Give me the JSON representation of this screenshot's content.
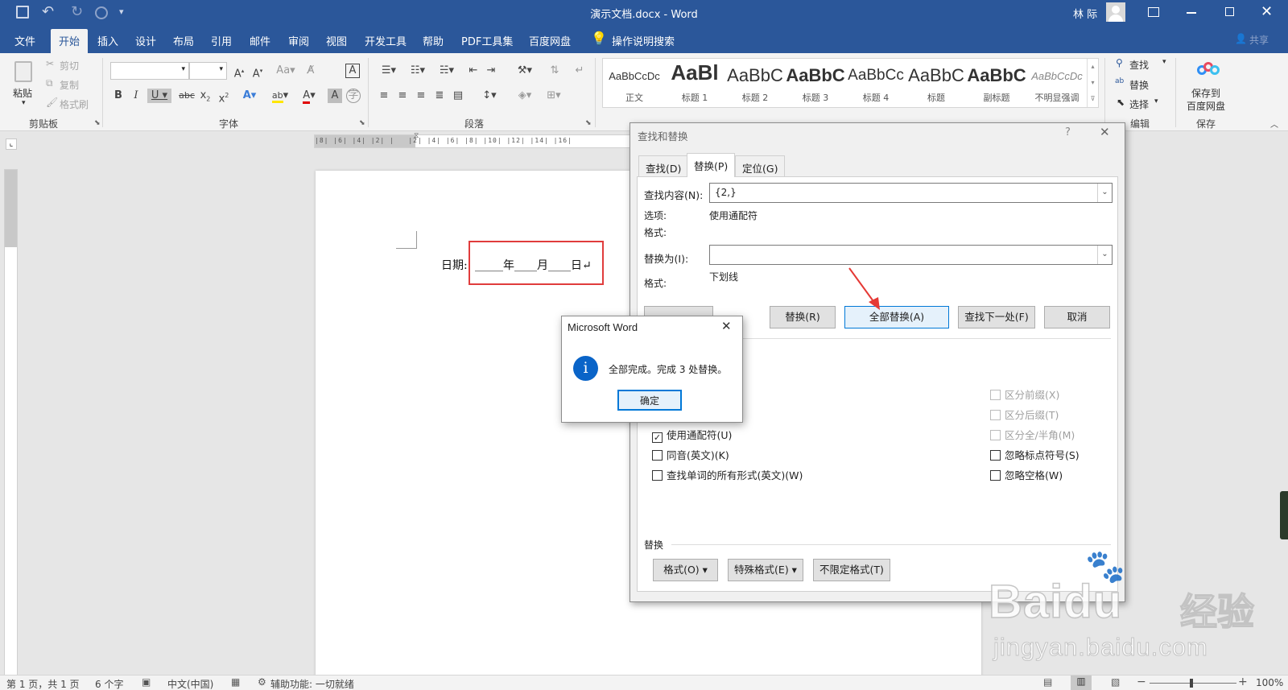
{
  "window": {
    "title": "演示文档.docx - Word",
    "user": "林 际",
    "share_label": "共享"
  },
  "tabs": [
    "文件",
    "开始",
    "插入",
    "设计",
    "布局",
    "引用",
    "邮件",
    "审阅",
    "视图",
    "开发工具",
    "帮助",
    "PDF工具集",
    "百度网盘"
  ],
  "tell_me": "操作说明搜索",
  "ribbon": {
    "clipboard": {
      "label": "剪贴板",
      "paste": "粘贴",
      "cut": "剪切",
      "copy": "复制",
      "format_painter": "格式刷"
    },
    "font_label": "字体",
    "paragraph_label": "段落",
    "styles": [
      {
        "preview": "AaBbCcDc",
        "name": "正文"
      },
      {
        "preview": "AaBl",
        "name": "标题 1"
      },
      {
        "preview": "AaBbC",
        "name": "标题 2"
      },
      {
        "preview": "AaBbC",
        "name": "标题 3"
      },
      {
        "preview": "AaBbCc",
        "name": "标题 4"
      },
      {
        "preview": "AaBbC",
        "name": "标题"
      },
      {
        "preview": "AaBbC",
        "name": "副标题"
      },
      {
        "preview": "AaBbCcDc",
        "name": "不明显强调"
      }
    ],
    "editing": {
      "label": "编辑",
      "find": "查找",
      "replace": "替换",
      "select": "选择"
    },
    "save": {
      "label": "保存",
      "baidu_line1": "保存到",
      "baidu_line2": "百度网盘"
    }
  },
  "document": {
    "date_label": "日期:",
    "line_text": "_____年____月____日↵"
  },
  "find_replace": {
    "title": "查找和替换",
    "help": "?",
    "tabs": [
      "查找(D)",
      "替换(P)",
      "定位(G)"
    ],
    "find_label": "查找内容(N):",
    "find_value": "{2,}",
    "options_label": "选项:",
    "options_value": "使用通配符",
    "format_label": "格式:",
    "replace_label": "替换为(I):",
    "replace_value": "",
    "replace_format_value": "下划线",
    "buttons": {
      "replace": "替换(R)",
      "replace_all": "全部替换(A)",
      "find_next": "查找下一处(F)",
      "cancel": "取消"
    },
    "left_checks": [
      {
        "label": "使用通配符(U)",
        "checked": true
      },
      {
        "label": "同音(英文)(K)",
        "checked": false
      },
      {
        "label": "查找单词的所有形式(英文)(W)",
        "checked": false
      }
    ],
    "right_checks": [
      {
        "label": "区分前缀(X)",
        "disabled": true
      },
      {
        "label": "区分后缀(T)",
        "disabled": true
      },
      {
        "label": "区分全/半角(M)",
        "disabled": true
      },
      {
        "label": "忽略标点符号(S)",
        "disabled": false
      },
      {
        "label": "忽略空格(W)",
        "disabled": false
      }
    ],
    "replace_section": "替换",
    "bottom_buttons": [
      "格式(O) ▾",
      "特殊格式(E) ▾",
      "不限定格式(T)"
    ]
  },
  "message_box": {
    "title": "Microsoft Word",
    "text": "全部完成。完成 3 处替换。",
    "ok": "确定"
  },
  "status": {
    "page": "第 1 页，共 1 页",
    "words": "6 个字",
    "lang": "中文(中国)",
    "accessibility": "辅助功能: 一切就绪",
    "zoom": "100%"
  },
  "watermark": {
    "brand": "Bai",
    "brand2": "du",
    "jingyan": "经验",
    "url": "jingyan.baidu.com"
  },
  "colors": {
    "accent": "#2b579a",
    "highlight_box": "#e03c3c",
    "info_icon": "#0a64c8"
  }
}
